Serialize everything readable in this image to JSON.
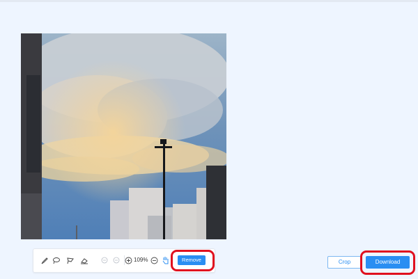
{
  "toolbar": {
    "tools": [
      {
        "name": "brush",
        "icon": "brush-icon"
      },
      {
        "name": "lasso",
        "icon": "lasso-icon"
      },
      {
        "name": "polygon-lasso",
        "icon": "polygon-lasso-icon"
      },
      {
        "name": "eraser",
        "icon": "eraser-icon"
      },
      {
        "name": "undo",
        "icon": "undo-icon",
        "enabled": false
      },
      {
        "name": "redo",
        "icon": "redo-icon",
        "enabled": false
      },
      {
        "name": "zoom-in",
        "icon": "zoom-in-icon"
      },
      {
        "name": "zoom-out",
        "icon": "zoom-out-icon"
      },
      {
        "name": "pan",
        "icon": "hand-icon"
      }
    ],
    "zoom_level": "109%",
    "remove_label": "Remove"
  },
  "actions": {
    "crop_label": "Crop",
    "download_label": "Download"
  },
  "colors": {
    "background": "#eef5ff",
    "accent": "#2a8ef2",
    "highlight": "#e0101f"
  },
  "photo": {
    "subject": "sky with clouds, street lamp and buildings"
  }
}
